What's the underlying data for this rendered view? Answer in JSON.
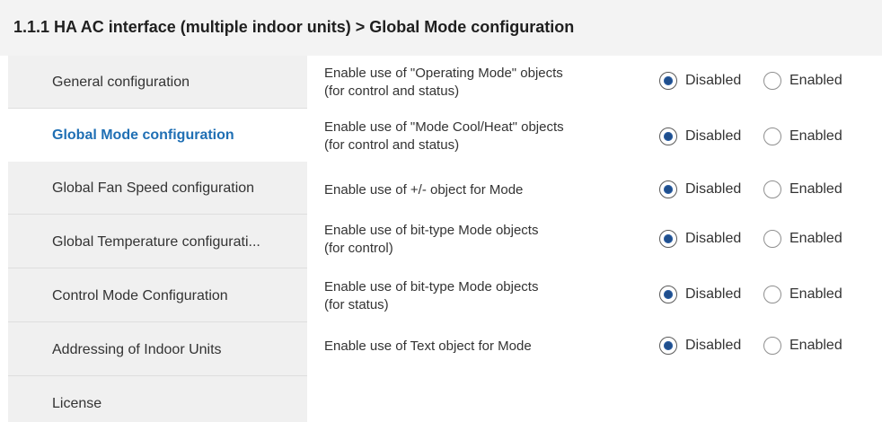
{
  "header": {
    "title": "1.1.1 HA AC interface (multiple indoor units) > Global Mode configuration"
  },
  "sidebar": {
    "items": [
      {
        "label": "General configuration",
        "active": false
      },
      {
        "label": "Global Mode configuration",
        "active": true
      },
      {
        "label": "Global Fan Speed configuration",
        "active": false
      },
      {
        "label": "Global Temperature configurati...",
        "active": false
      },
      {
        "label": "Control Mode Configuration",
        "active": false
      },
      {
        "label": "Addressing of Indoor Units",
        "active": false
      },
      {
        "label": "License",
        "active": false
      }
    ]
  },
  "settings": {
    "rows": [
      {
        "label_line1": "Enable use of \"Operating Mode\" objects",
        "label_line2": "(for control and status)",
        "option_disabled": "Disabled",
        "option_enabled": "Enabled",
        "selected": "Disabled"
      },
      {
        "label_line1": "Enable use of \"Mode Cool/Heat\" objects",
        "label_line2": "(for control and status)",
        "option_disabled": "Disabled",
        "option_enabled": "Enabled",
        "selected": "Disabled"
      },
      {
        "label_line1": "Enable use of +/- object for Mode",
        "label_line2": "",
        "option_disabled": "Disabled",
        "option_enabled": "Enabled",
        "selected": "Disabled"
      },
      {
        "label_line1": "Enable use of bit-type Mode objects",
        "label_line2": "(for control)",
        "option_disabled": "Disabled",
        "option_enabled": "Enabled",
        "selected": "Disabled"
      },
      {
        "label_line1": "Enable use of bit-type Mode objects",
        "label_line2": "(for status)",
        "option_disabled": "Disabled",
        "option_enabled": "Enabled",
        "selected": "Disabled"
      },
      {
        "label_line1": "Enable use of Text object for Mode",
        "label_line2": "",
        "option_disabled": "Disabled",
        "option_enabled": "Enabled",
        "selected": "Disabled"
      }
    ]
  },
  "colors": {
    "accent": "#1f6fb4",
    "radio_dot": "#1f4e8c",
    "sidebar_bg": "#f0f0f0",
    "header_bg": "#f3f3f3"
  }
}
